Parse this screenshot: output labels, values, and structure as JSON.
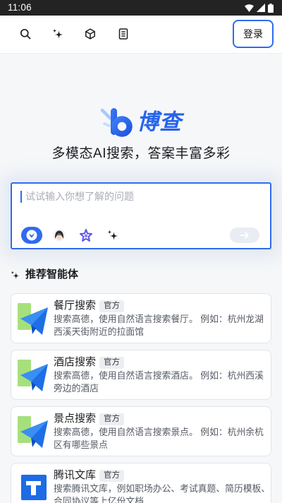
{
  "status_bar": {
    "time": "11:06",
    "icons": [
      "wifi-icon",
      "signal-icon",
      "battery-icon"
    ]
  },
  "toolbar": {
    "icons": [
      "search-icon",
      "sparkle-icon",
      "cube-icon",
      "document-icon"
    ],
    "login_label": "登录"
  },
  "brand": {
    "logo_icon": "bocha-logo-icon",
    "name": "博查",
    "tagline": "多模态AI搜索，答案丰富多彩"
  },
  "search": {
    "placeholder": "试试输入你想了解的问题",
    "value": "",
    "model_icons": [
      "bocha-model-icon",
      "avatar-model-icon",
      "star-model-icon",
      "sparkle-model-icon"
    ],
    "selected_model_index": 0,
    "send_icon": "send-arrow-icon"
  },
  "recommend": {
    "icon": "sparkle-icon",
    "heading": "推荐智能体",
    "agents": [
      {
        "icon": "paper-plane-icon",
        "title": "餐厅搜索",
        "badge": "官方",
        "description": "搜索高德，使用自然语言搜索餐厅。 例如：杭州龙湖西溪天街附近的拉面馆"
      },
      {
        "icon": "paper-plane-icon",
        "title": "酒店搜索",
        "badge": "官方",
        "description": "搜索高德，使用自然语言搜索酒店。 例如：杭州西溪旁边的酒店"
      },
      {
        "icon": "paper-plane-icon",
        "title": "景点搜索",
        "badge": "官方",
        "description": "搜索高德，使用自然语言搜索景点。 例如：杭州余杭区有哪些景点"
      },
      {
        "icon": "tencent-wenku-icon",
        "title": "腾讯文库",
        "badge": "官方",
        "description": "搜索腾讯文库，例如职场办公、考试真题、简历模板、合同协议等上亿份文档"
      }
    ]
  },
  "colors": {
    "accent": "#2f6bf1",
    "brand_blue": "#2563eb",
    "text_primary": "#1c1d21",
    "text_secondary": "#545a64",
    "badge_bg": "#eceef1",
    "page_bg": "#f6f7f9",
    "status_bar_bg": "#232323"
  }
}
